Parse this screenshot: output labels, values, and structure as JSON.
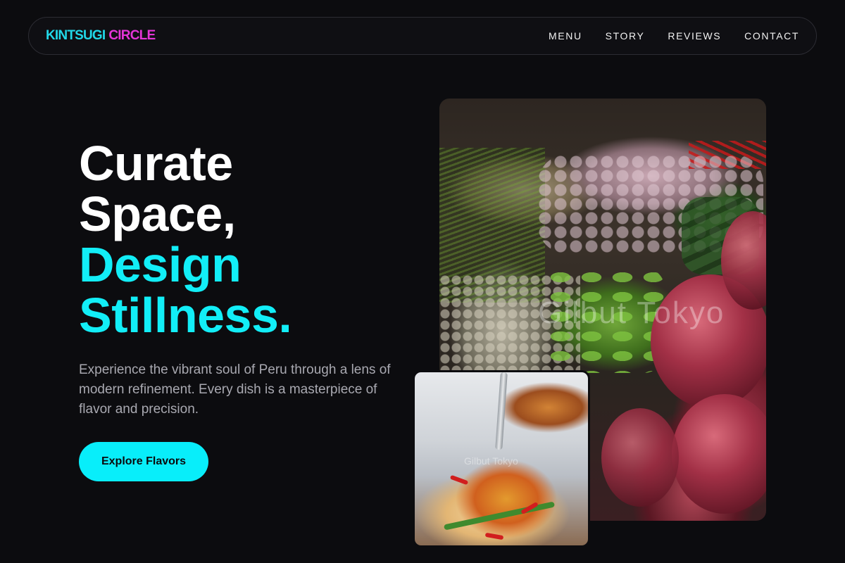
{
  "brand": {
    "part1": "KINTSUGI",
    "part2": "CIRCLE",
    "color1": "#21d8e8",
    "color2": "#e535d8"
  },
  "nav": {
    "items": [
      {
        "label": "MENU"
      },
      {
        "label": "STORY"
      },
      {
        "label": "REVIEWS"
      },
      {
        "label": "CONTACT"
      }
    ]
  },
  "hero": {
    "line1": "Curate",
    "line2": "Space,",
    "line3": "Design",
    "line4": "Stillness.",
    "description": "Experience the vibrant soul of Peru through a lens of modern refinement. Every dish is a masterpiece of flavor and precision.",
    "cta_label": "Explore Flavors",
    "accent_color": "#12eef7"
  },
  "images": {
    "main": {
      "icon": "market-produce-photo",
      "watermark": "Gilbut Tokyo"
    },
    "inset": {
      "icon": "pasta-dish-photo",
      "watermark": "Gilbut Tokyo"
    }
  }
}
